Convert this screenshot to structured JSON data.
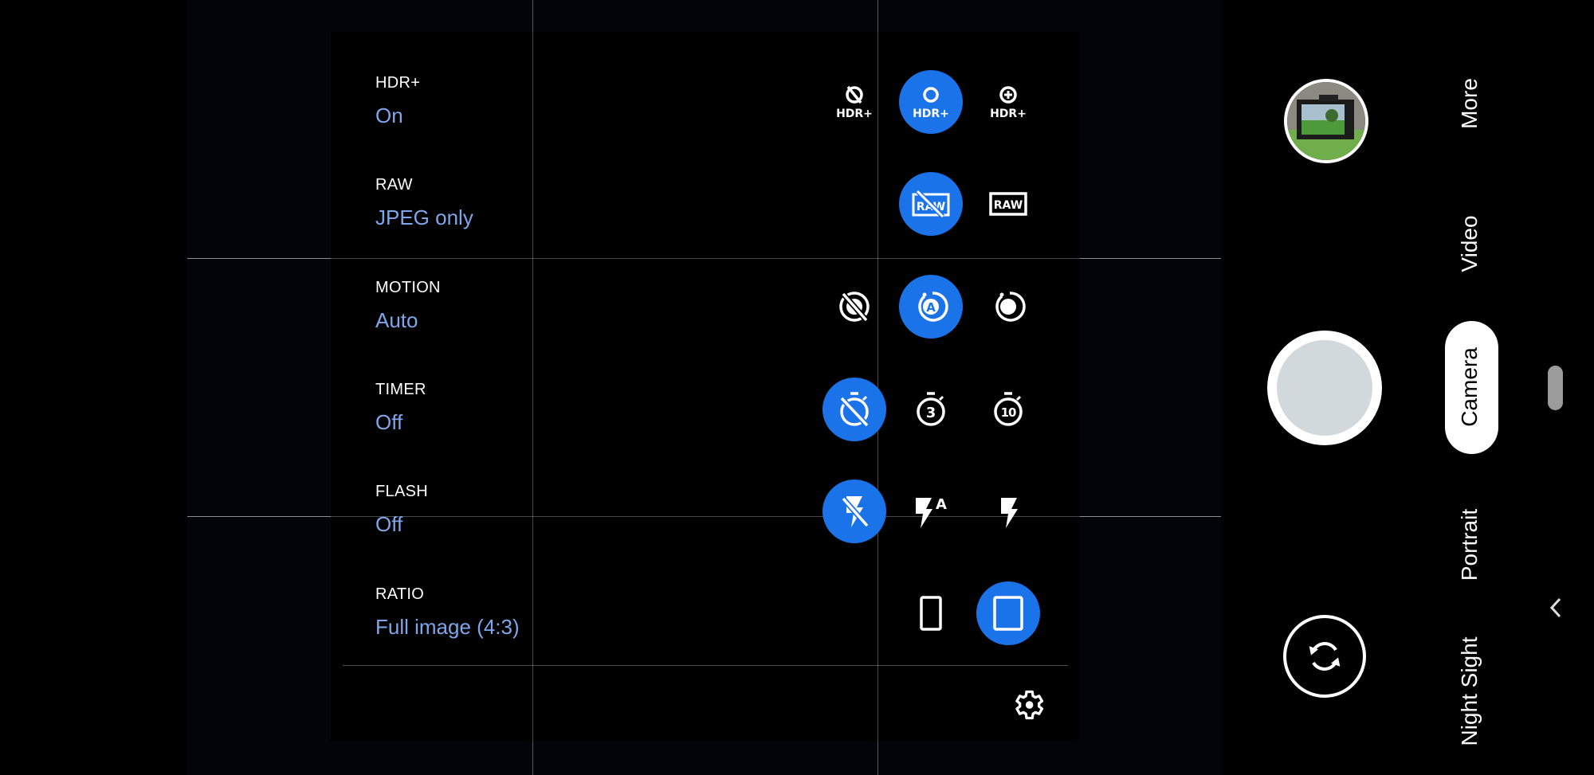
{
  "settings": [
    {
      "label": "HDR+",
      "value": "On"
    },
    {
      "label": "RAW",
      "value": "JPEG only"
    },
    {
      "label": "MOTION",
      "value": "Auto"
    },
    {
      "label": "TIMER",
      "value": "Off"
    },
    {
      "label": "FLASH",
      "value": "Off"
    },
    {
      "label": "RATIO",
      "value": "Full image (4:3)"
    }
  ],
  "options": {
    "hdr": [
      {
        "icon": "hdr-off-icon",
        "text": "HDR+",
        "selected": false
      },
      {
        "icon": "hdr-on-icon",
        "text": "HDR+",
        "selected": true
      },
      {
        "icon": "hdr-enhanced-icon",
        "text": "HDR+",
        "selected": false
      }
    ],
    "raw": [
      {
        "icon": "raw-off-icon",
        "text": "RAW",
        "selected": true
      },
      {
        "icon": "raw-on-icon",
        "text": "RAW",
        "selected": false
      }
    ],
    "motion": [
      {
        "icon": "motion-off-icon",
        "selected": false
      },
      {
        "icon": "motion-auto-icon",
        "text": "A",
        "selected": true
      },
      {
        "icon": "motion-on-icon",
        "selected": false
      }
    ],
    "timer": [
      {
        "icon": "timer-off-icon",
        "selected": true
      },
      {
        "icon": "timer-3-icon",
        "text": "3",
        "selected": false
      },
      {
        "icon": "timer-10-icon",
        "text": "10",
        "selected": false
      }
    ],
    "flash": [
      {
        "icon": "flash-off-icon",
        "selected": true
      },
      {
        "icon": "flash-auto-icon",
        "text": "A",
        "selected": false
      },
      {
        "icon": "flash-on-icon",
        "selected": false
      }
    ],
    "ratio": [
      {
        "icon": "ratio-wide-icon",
        "selected": false
      },
      {
        "icon": "ratio-full-icon",
        "selected": true
      }
    ]
  },
  "modes": [
    "More",
    "Video",
    "Camera",
    "Portrait",
    "Night Sight"
  ],
  "active_mode": "Camera",
  "colors": {
    "accent": "#1a73e8",
    "value_text": "#7ea6ea"
  }
}
